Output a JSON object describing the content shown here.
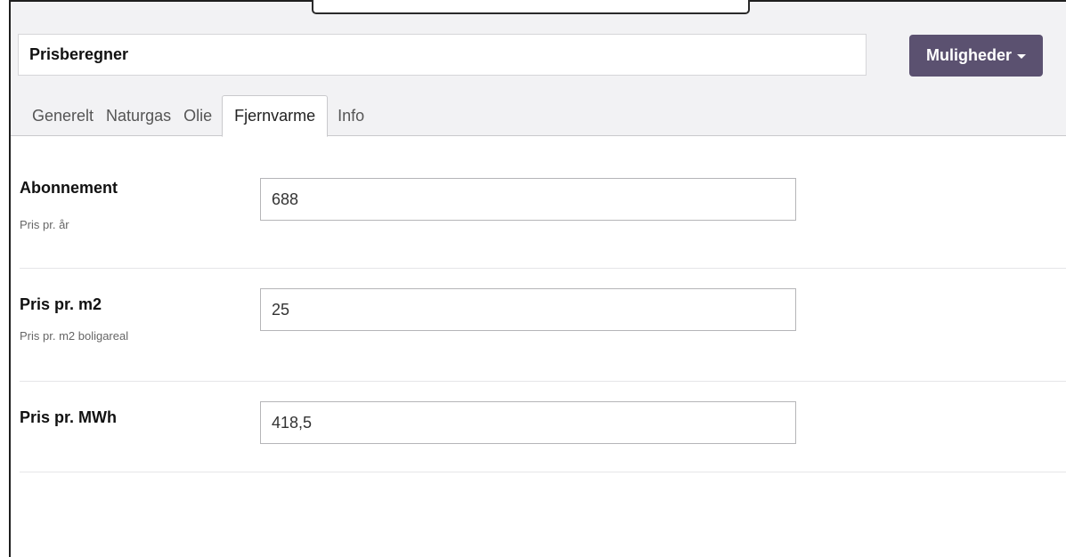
{
  "header": {
    "title": "Prisberegner",
    "options_label": "Muligheder"
  },
  "tabs": [
    {
      "label": "Generelt",
      "active": false
    },
    {
      "label": "Naturgas",
      "active": false
    },
    {
      "label": "Olie",
      "active": false
    },
    {
      "label": "Fjernvarme",
      "active": true
    },
    {
      "label": "Info",
      "active": false
    }
  ],
  "fields": [
    {
      "label": "Abonnement",
      "sublabel": "Pris pr. år",
      "value": "688"
    },
    {
      "label": "Pris pr. m2",
      "sublabel": "Pris pr. m2 boligareal",
      "value": "25"
    },
    {
      "label": "Pris pr. MWh",
      "sublabel": "",
      "value": "418,5"
    }
  ],
  "colors": {
    "options_button": "#5b5170",
    "header_background": "#f2f2f4"
  }
}
